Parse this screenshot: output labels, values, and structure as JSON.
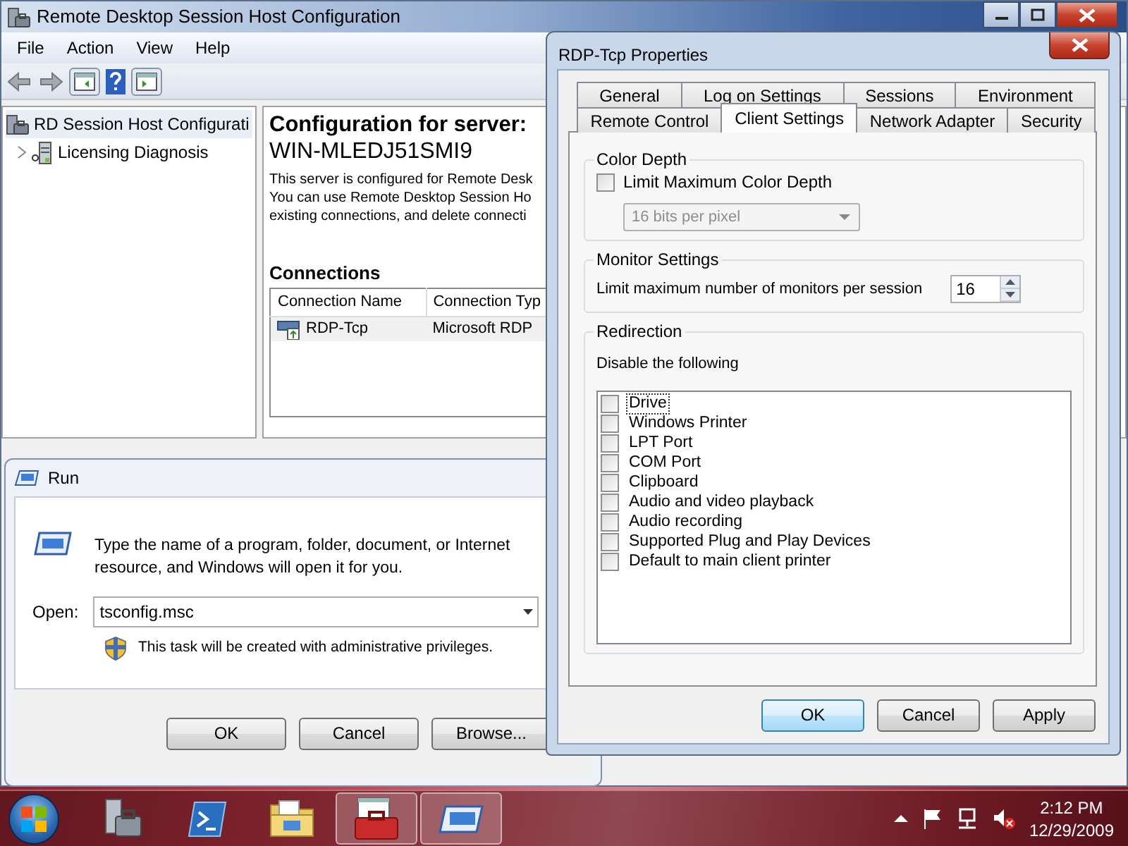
{
  "main_window": {
    "title": "Remote Desktop Session Host Configuration",
    "menu": [
      "File",
      "Action",
      "View",
      "Help"
    ],
    "tree": [
      {
        "label": "RD Session Host Configurati",
        "kind": "root",
        "selected": true
      },
      {
        "label": "Licensing Diagnosis",
        "kind": "node",
        "selected": false
      }
    ],
    "heading": "Configuration for server:",
    "server": "WIN-MLEDJ51SMI9",
    "description": [
      "This server is configured for Remote Desk",
      "You can use Remote Desktop Session Ho",
      "existing connections, and delete connecti"
    ],
    "connections_title": "Connections",
    "columns": [
      "Connection Name",
      "Connection Typ"
    ],
    "rows": [
      [
        "RDP-Tcp",
        "Microsoft RDP"
      ]
    ]
  },
  "run_dialog": {
    "title": "Run",
    "prompt": "Type the name of a program, folder, document, or Internet resource, and Windows will open it for you.",
    "open_label": "Open:",
    "value": "tsconfig.msc",
    "notice": "This task will be created with administrative privileges.",
    "buttons": [
      "OK",
      "Cancel",
      "Browse..."
    ]
  },
  "properties_dialog": {
    "title": "RDP-Tcp Properties",
    "tab_rows": [
      [
        {
          "label": "General",
          "selected": false
        },
        {
          "label": "Log on Settings",
          "selected": false
        },
        {
          "label": "Sessions",
          "selected": false
        },
        {
          "label": "Environment",
          "selected": false
        }
      ],
      [
        {
          "label": "Remote Control",
          "selected": false
        },
        {
          "label": "Client Settings",
          "selected": true
        },
        {
          "label": "Network Adapter",
          "selected": false
        },
        {
          "label": "Security",
          "selected": false
        }
      ]
    ],
    "color_depth": {
      "legend": "Color Depth",
      "checkbox": {
        "label": "Limit Maximum Color Depth",
        "checked": false
      },
      "select": {
        "value": "16 bits per pixel",
        "disabled": true
      }
    },
    "monitor_settings": {
      "legend": "Monitor Settings",
      "label": "Limit maximum number of monitors per session",
      "value": "16"
    },
    "redirection": {
      "legend": "Redirection",
      "label": "Disable the following",
      "items": [
        {
          "label": "Drive",
          "checked": false,
          "focused": true
        },
        {
          "label": "Windows Printer",
          "checked": false,
          "focused": false
        },
        {
          "label": "LPT Port",
          "checked": false,
          "focused": false
        },
        {
          "label": "COM Port",
          "checked": false,
          "focused": false
        },
        {
          "label": "Clipboard",
          "checked": false,
          "focused": false
        },
        {
          "label": "Audio and video playback",
          "checked": false,
          "focused": false
        },
        {
          "label": "Audio recording",
          "checked": false,
          "focused": false
        },
        {
          "label": "Supported Plug and Play Devices",
          "checked": false,
          "focused": false
        },
        {
          "label": "Default to main client printer",
          "checked": false,
          "focused": false
        }
      ]
    },
    "buttons": [
      {
        "label": "OK",
        "default": true
      },
      {
        "label": "Cancel",
        "default": false
      },
      {
        "label": "Apply",
        "default": false
      }
    ]
  },
  "taskbar": {
    "apps": [
      {
        "kind": "server-tools",
        "selected": false
      },
      {
        "kind": "shell",
        "selected": false
      },
      {
        "kind": "folder",
        "selected": false
      },
      {
        "kind": "toolbox",
        "selected": true
      },
      {
        "kind": "run",
        "selected": true
      }
    ],
    "time": "2:12 PM",
    "date": "12/29/2009"
  }
}
